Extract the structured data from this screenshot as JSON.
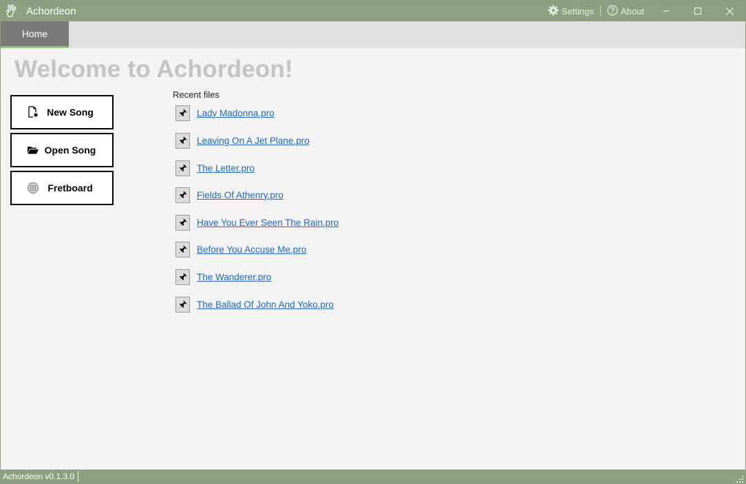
{
  "window": {
    "title": "Achordeon",
    "app_icon": "hand-icon",
    "settings_label": "Settings",
    "about_label": "About",
    "title_color": "#8aa07e"
  },
  "tabs": [
    {
      "label": "Home",
      "active": true
    }
  ],
  "home": {
    "welcome": "Welcome to Achordeon!",
    "actions": [
      {
        "label": "New Song",
        "icon": "new-file-icon"
      },
      {
        "label": "Open Song",
        "icon": "folder-open-icon"
      },
      {
        "label": "Fretboard",
        "icon": "grid-icon"
      }
    ],
    "recent_title": "Recent files",
    "recent_files": [
      "Lady Madonna.pro",
      "Leaving On A Jet Plane.pro",
      "The Letter.pro",
      "Fields Of Athenry.pro",
      "Have You Ever Seen The Rain.pro",
      "Before You Accuse Me.pro",
      "The Wanderer.pro",
      "The Ballad Of John And Yoko.pro"
    ]
  },
  "status": {
    "version": "Achordeon v0.1.3.0"
  },
  "colors": {
    "accent": "#8aa07e",
    "tab_indicator": "#7ed36b",
    "link": "#1f66c2"
  }
}
